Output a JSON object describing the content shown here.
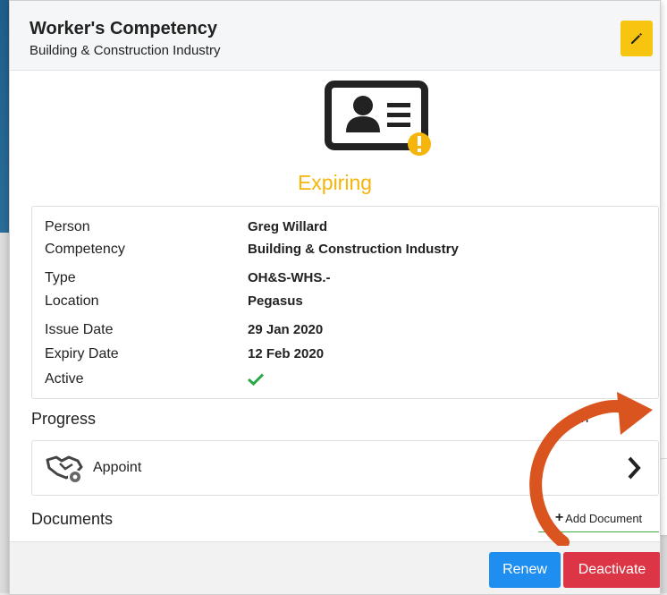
{
  "header": {
    "title": "Worker's Competency",
    "subtitle": "Building & Construction Industry",
    "edit_icon": "pencil-icon"
  },
  "status": {
    "label": "Expiring",
    "icon": "id-card-warning-icon",
    "color": "#f5b50a"
  },
  "details": [
    {
      "label": "Person",
      "value": "Greg Willard"
    },
    {
      "label": "Competency",
      "value": "Building & Construction Industry"
    },
    {
      "label": "Type",
      "value": "OH&S-WHS.-"
    },
    {
      "label": "Location",
      "value": "Pegasus"
    },
    {
      "label": "Issue Date",
      "value": "29 Jan 2020"
    },
    {
      "label": "Expiry Date",
      "value": "12 Feb 2020"
    },
    {
      "label": "Active",
      "value_icon": "check-icon"
    }
  ],
  "progress": {
    "title": "Progress",
    "right_label": "In",
    "step_label": "Appoint",
    "step_icon": "handshake-icon"
  },
  "documents": {
    "title": "Documents",
    "add_label": "Add Document"
  },
  "footer": {
    "renew_label": "Renew",
    "deactivate_label": "Deactivate"
  },
  "colors": {
    "accent_warning": "#f5b50a",
    "renew": "#1f8ef1",
    "deactivate": "#dc3545",
    "check": "#28a745",
    "annotation_arrow": "#d9541e"
  }
}
